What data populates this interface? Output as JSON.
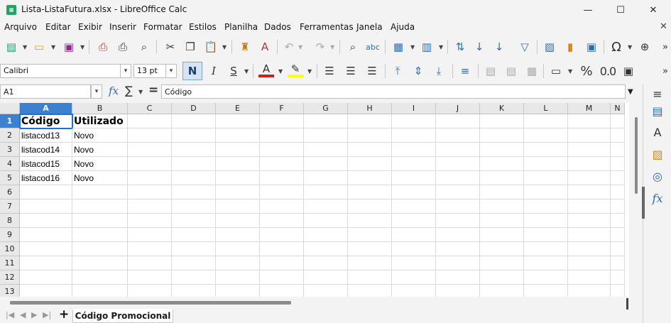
{
  "window": {
    "title": "Lista-ListaFutura.xlsx - LibreOffice Calc",
    "app_icon": "calc-icon",
    "minimize": "—",
    "maximize": "☐",
    "close": "✕"
  },
  "menu": [
    {
      "label": "Arquivo"
    },
    {
      "label": "Editar"
    },
    {
      "label": "Exibir"
    },
    {
      "label": "Inserir"
    },
    {
      "label": "Formatar"
    },
    {
      "label": "Estilos"
    },
    {
      "label": "Planilha"
    },
    {
      "label": "Dados"
    },
    {
      "label": "Ferramentas"
    },
    {
      "label": "Janela"
    },
    {
      "label": "Ajuda"
    }
  ],
  "menu_close": "✕",
  "format": {
    "font_name": "Calibri",
    "font_size": "13 pt",
    "bold": "N",
    "italic": "I",
    "underline": "S",
    "number_percent": "%",
    "number_decimal": "0.0"
  },
  "formula_bar": {
    "name_box": "A1",
    "content": "Código"
  },
  "columns": [
    "A",
    "B",
    "C",
    "D",
    "E",
    "F",
    "G",
    "H",
    "I",
    "J",
    "K",
    "L",
    "M",
    "N"
  ],
  "rows": [
    "1",
    "2",
    "3",
    "4",
    "5",
    "6",
    "7",
    "8",
    "9",
    "10",
    "11",
    "12",
    "13"
  ],
  "cells": {
    "A1": "Código",
    "B1": "Utilizado",
    "A2": "listacod13",
    "B2": "Novo",
    "A3": "listacod14",
    "B3": "Novo",
    "A4": "listacod15",
    "B4": "Novo",
    "A5": "listacod16",
    "B5": "Novo"
  },
  "active_cell": "A1",
  "sheets": [
    {
      "label": "Código Promocional",
      "active": true
    }
  ],
  "colors": {
    "selection": "#3e80d0",
    "accent": "#2f6db3",
    "calc_green": "#21a366"
  }
}
